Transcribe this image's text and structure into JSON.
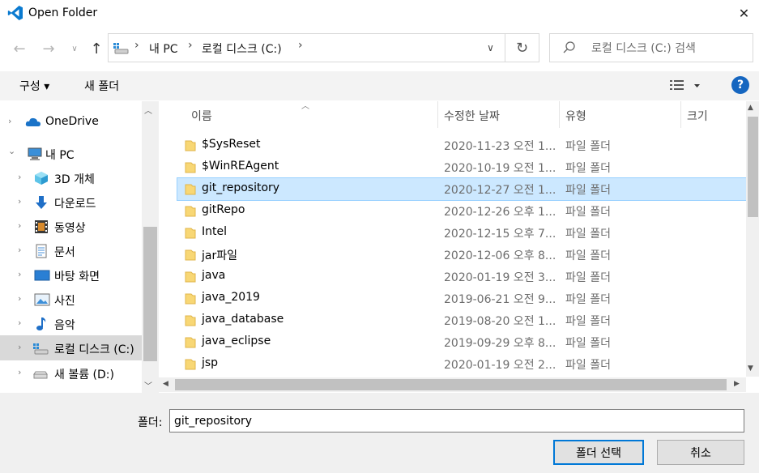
{
  "window": {
    "title": "Open Folder",
    "close_glyph": "✕"
  },
  "nav": {
    "back_glyph": "←",
    "forward_glyph": "→",
    "recent_glyph": "∨",
    "up_glyph": "↑"
  },
  "address": {
    "breadcrumbs": [
      "내 PC",
      "로컬 디스크 (C:)"
    ],
    "separator": "›",
    "dropdown_glyph": "∨",
    "refresh_glyph": "↻"
  },
  "search": {
    "placeholder": "로컬 디스크 (C:) 검색"
  },
  "toolbar": {
    "organize_label": "구성 ▾",
    "new_folder_label": "새 폴더",
    "help_label": "?"
  },
  "sidebar": {
    "items": [
      {
        "label": "OneDrive",
        "icon": "cloud-icon",
        "chevron": "›"
      },
      {
        "label": "내 PC",
        "icon": "computer-icon",
        "chevron": "⌄"
      },
      {
        "label": "3D 개체",
        "icon": "cube-icon",
        "chevron": "›"
      },
      {
        "label": "다운로드",
        "icon": "download-icon",
        "chevron": "›"
      },
      {
        "label": "동영상",
        "icon": "film-icon",
        "chevron": "›"
      },
      {
        "label": "문서",
        "icon": "document-icon",
        "chevron": "›"
      },
      {
        "label": "바탕 화면",
        "icon": "desktop-icon",
        "chevron": "›"
      },
      {
        "label": "사진",
        "icon": "picture-icon",
        "chevron": "›"
      },
      {
        "label": "음악",
        "icon": "music-icon",
        "chevron": "›"
      },
      {
        "label": "로컬 디스크 (C:)",
        "icon": "drive-icon",
        "chevron": "›"
      },
      {
        "label": "새 볼륨 (D:)",
        "icon": "drive-icon",
        "chevron": "›"
      }
    ]
  },
  "columns": {
    "name": "이름",
    "date": "수정한 날짜",
    "type": "유형",
    "size": "크기"
  },
  "files": [
    {
      "name": "$SysReset",
      "date": "2020-11-23 오전 1...",
      "type": "파일 폴더"
    },
    {
      "name": "$WinREAgent",
      "date": "2020-10-19 오전 1...",
      "type": "파일 폴더"
    },
    {
      "name": "git_repository",
      "date": "2020-12-27 오전 1...",
      "type": "파일 폴더"
    },
    {
      "name": "gitRepo",
      "date": "2020-12-26 오후 1...",
      "type": "파일 폴더"
    },
    {
      "name": "Intel",
      "date": "2020-12-15 오후 7...",
      "type": "파일 폴더"
    },
    {
      "name": "jar파일",
      "date": "2020-12-06 오후 8...",
      "type": "파일 폴더"
    },
    {
      "name": "java",
      "date": "2020-01-19 오전 3...",
      "type": "파일 폴더"
    },
    {
      "name": "java_2019",
      "date": "2019-06-21 오전 9...",
      "type": "파일 폴더"
    },
    {
      "name": "java_database",
      "date": "2019-08-20 오전 1...",
      "type": "파일 폴더"
    },
    {
      "name": "java_eclipse",
      "date": "2019-09-29 오후 8...",
      "type": "파일 폴더"
    },
    {
      "name": "jsp",
      "date": "2020-01-19 오전 2...",
      "type": "파일 폴더"
    }
  ],
  "bottom": {
    "folder_label": "폴더:",
    "folder_value": "git_repository",
    "select_label": "폴더 선택",
    "cancel_label": "취소"
  },
  "colors": {
    "accent": "#0078d7",
    "selection": "#cce8ff",
    "folder": "#f8d775"
  }
}
